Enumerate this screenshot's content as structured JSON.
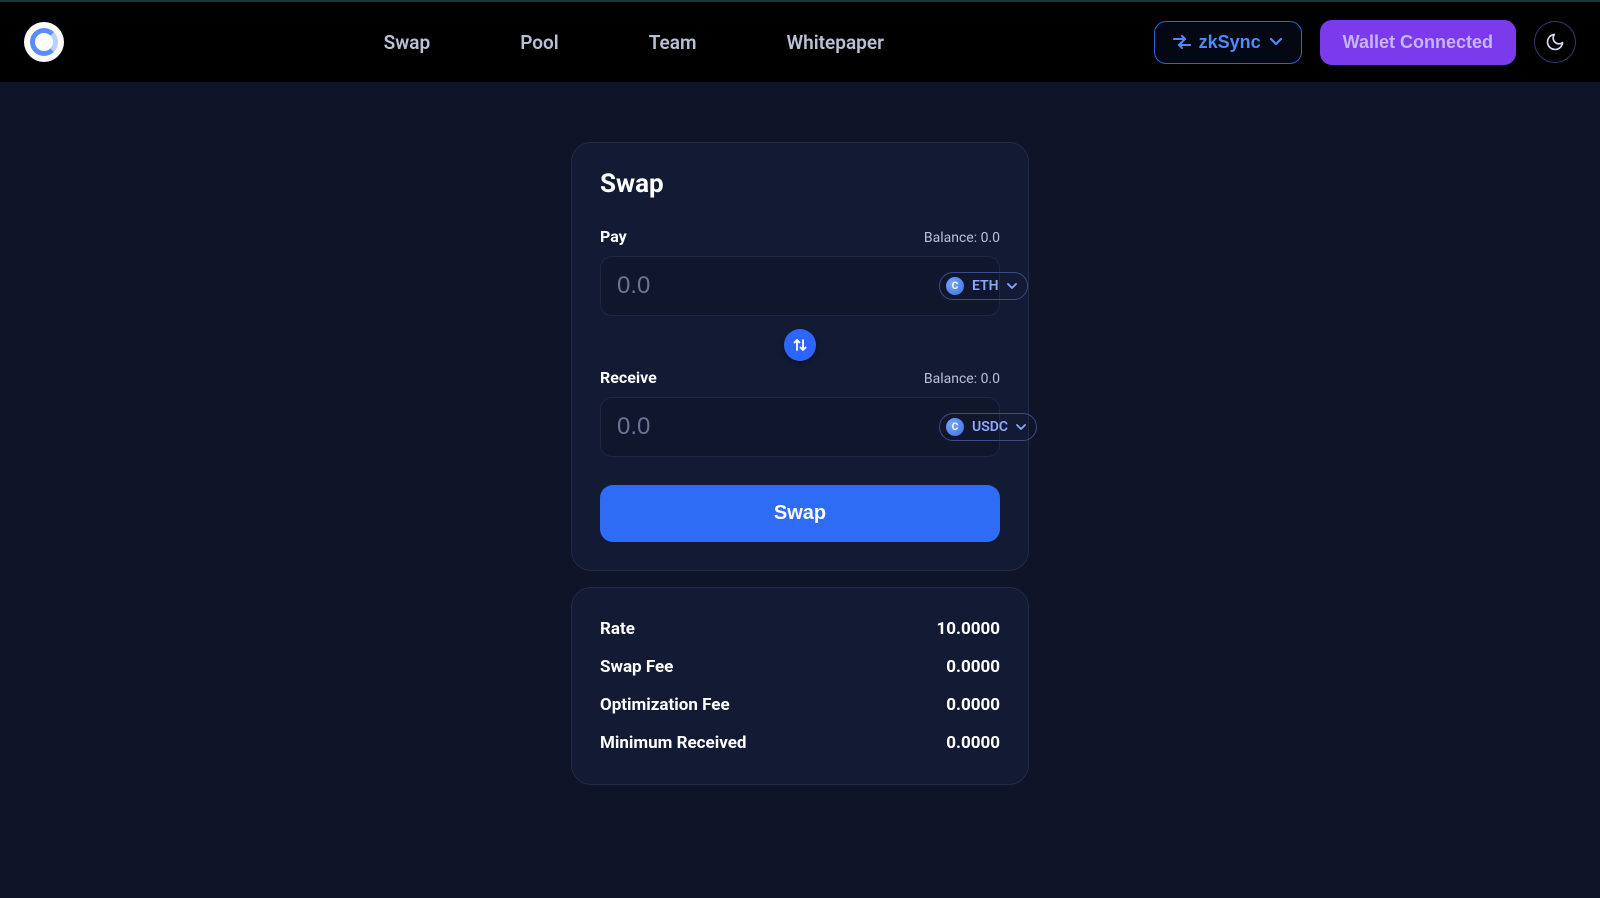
{
  "nav": {
    "items": [
      "Swap",
      "Pool",
      "Team",
      "Whitepaper"
    ]
  },
  "header": {
    "network_label": "zkSync",
    "wallet_label": "Wallet Connected"
  },
  "swap": {
    "title": "Swap",
    "pay_label": "Pay",
    "pay_balance": "Balance: 0.0",
    "pay_placeholder": "0.0",
    "pay_token": "ETH",
    "receive_label": "Receive",
    "receive_balance": "Balance: 0.0",
    "receive_placeholder": "0.0",
    "receive_token": "USDC",
    "button_label": "Swap"
  },
  "info": {
    "rows": [
      {
        "label": "Rate",
        "value": "10.0000"
      },
      {
        "label": "Swap Fee",
        "value": "0.0000"
      },
      {
        "label": "Optimization Fee",
        "value": "0.0000"
      },
      {
        "label": "Minimum Received",
        "value": "0.0000"
      }
    ]
  }
}
